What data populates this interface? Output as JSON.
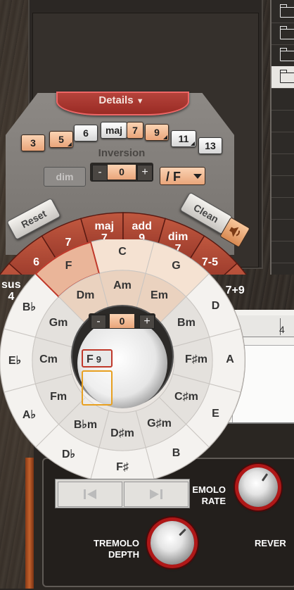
{
  "colors": {
    "accent_orange": "#e9a57a",
    "ring_red": "#a23a2e",
    "selected_red": "#c0392b",
    "panel_gray": "#807c78"
  },
  "browser": {
    "folders": [
      {
        "icon": "folder-icon"
      },
      {
        "icon": "folder-icon"
      },
      {
        "icon": "folder-icon"
      },
      {
        "icon": "folder-icon",
        "selected": true
      }
    ]
  },
  "details": {
    "title": "Details",
    "extensions": [
      {
        "label": "3",
        "active": true
      },
      {
        "label": "5",
        "active": true,
        "has_menu": true
      },
      {
        "label": "6",
        "active": false
      },
      {
        "label": "maj",
        "active": false
      },
      {
        "label": "7",
        "active": true
      },
      {
        "label": "9",
        "active": true,
        "has_menu": true
      },
      {
        "label": "11",
        "active": false,
        "has_menu": true
      },
      {
        "label": "13",
        "active": false
      }
    ],
    "inversion_label": "Inversion",
    "inversion_value": "0",
    "minus": "-",
    "plus": "+",
    "dim_label": "dim",
    "bass_label": "/ F"
  },
  "actions": {
    "reset": "Reset",
    "clean": "Clean"
  },
  "chord_types": [
    {
      "label": "sus\n4"
    },
    {
      "label": "6"
    },
    {
      "label": "7"
    },
    {
      "label": "maj\n7"
    },
    {
      "label": "add\n9"
    },
    {
      "label": "dim\n7"
    },
    {
      "label": "7-5"
    },
    {
      "label": "7+9"
    }
  ],
  "circle": {
    "major_keys": [
      "C",
      "G",
      "D",
      "A",
      "E",
      "B",
      "F♯",
      "D♭",
      "A♭",
      "E♭",
      "B♭",
      "F"
    ],
    "minor_keys": [
      "Am",
      "Em",
      "Bm",
      "F♯m",
      "C♯m",
      "G♯m",
      "D♯m",
      "B♭m",
      "Fm",
      "Cm",
      "Gm",
      "Dm"
    ],
    "selected_key": "F",
    "center_value": "0"
  },
  "chord_slot": {
    "chord": "F",
    "extension": "9"
  },
  "timeline": {
    "ruler_mark": "4"
  },
  "instrument": {
    "tremolo_rate_label": "TREMOLO\nRATE",
    "tremolo_rate_label_visible": "EMOLO\nRATE",
    "tremolo_depth_label": "TREMOLO\nDEPTH",
    "reverb_label": "REVERB",
    "reverb_label_visible": "REVER",
    "prev_icon": "skip-back-icon",
    "next_icon": "skip-forward-icon"
  }
}
